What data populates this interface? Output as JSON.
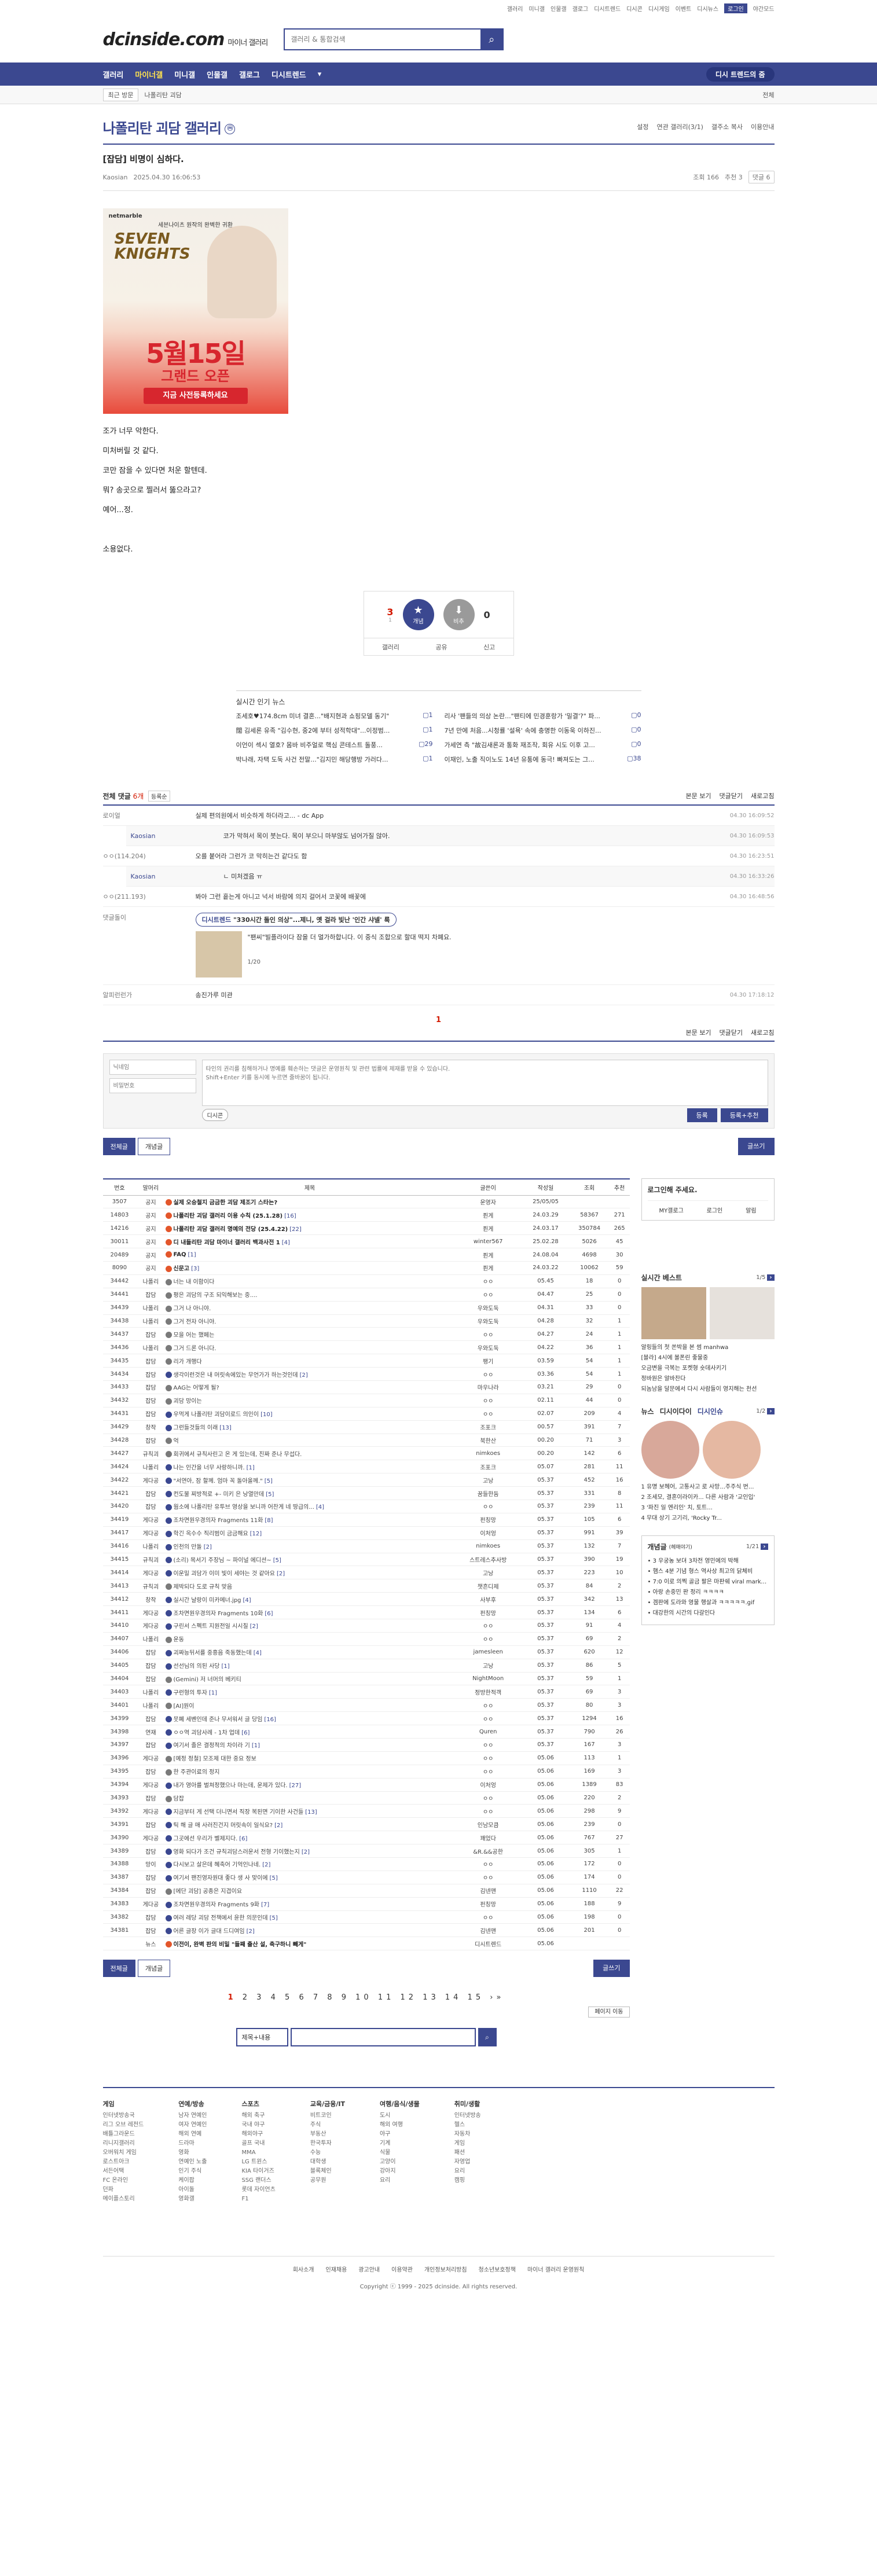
{
  "util": [
    "갤러리",
    "미니갤",
    "인물갤",
    "갤로그",
    "디시트렌드",
    "디시콘",
    "디시게임",
    "이벤트",
    "디시뉴스",
    "로그인",
    "야간모드"
  ],
  "logo": {
    "main": "dcinside.com",
    "sub": "마이너 갤러리"
  },
  "search": {
    "placeholder": "갤러리 & 통합검색"
  },
  "gnb": {
    "items": [
      "갤러리",
      "마이너갤",
      "미니갤",
      "인물갤",
      "갤로그",
      "디시트렌드"
    ],
    "selected": "마이너갤",
    "right": "디시 트렌드의 줌"
  },
  "sub": {
    "tag": "최근 방문",
    "item": "나폴리탄 괴담",
    "more": "전체"
  },
  "gallery": {
    "title": "나폴리탄 괴담 갤러리",
    "badge": "ⓜ",
    "opts": [
      "설정",
      "연관 갤러리(3/1)",
      "갤주소 복사",
      "이용안내"
    ]
  },
  "post": {
    "title": "[잡담] 비명이 심하다.",
    "author": "Kaosian",
    "date": "2025.04.30 16:06:53",
    "views": "조회 166",
    "recommend": "추천 3",
    "comments": "댓글 6",
    "body": [
      "조가 너무 악한다.",
      "미처버릴 것 같다.",
      "코만 잠을 수 있다면 처운 할텐데.",
      "뭐? 송곳으로 찔러서 뚫으라고?",
      "예어...정.",
      "",
      "소용없다."
    ]
  },
  "ad": {
    "brand": "netmarble",
    "tag": "세븐나이츠 원작의 완벽한 귀환",
    "game": "SEVEN KNIGHTS",
    "big": "5월15일",
    "mid": "그랜드 오픈",
    "cta": "지금 사전등록하세요"
  },
  "vote": {
    "up": "3",
    "upSub": "1",
    "upLabel": "개념",
    "downLabel": "비추",
    "down": "0",
    "actions": [
      "갤러리",
      "공유",
      "신고"
    ]
  },
  "news": {
    "title": "실시간 인기 뉴스",
    "items": [
      {
        "t": "조세호♥174.8cm 미녀 결혼...\"배지현과 쇼핑모델 동기\"",
        "c": "1"
      },
      {
        "t": "리사 '팬들의 의상 논란...\"팬티에 민경훈랑가 '밀결'?\" 파...",
        "c": "0"
      },
      {
        "t": "闊 김세론 유족 \"김수현, 중2에 부터 성적학대\"...이정범...",
        "c": "1"
      },
      {
        "t": "7년 만에 처음...시청률 '설욕' 속에 충명한 이동욱 이하진...",
        "c": "0"
      },
      {
        "t": "이언이 섹시 열호? 몸바 비주얼로 핵심 콘테스트 돌풍...",
        "c": "29"
      },
      {
        "t": "가세연 측 \"故김새론과 통화 재조작, 회유 시도 이후 고...",
        "c": "0"
      },
      {
        "t": "박나래, 자택 도둑 사건 전말...\"김지민 해당행방 가러다...",
        "c": "1"
      },
      {
        "t": "이재인, 노출 직이노도 14년 유통에 동극! 빠져도는 그...",
        "c": "38"
      }
    ]
  },
  "comments": {
    "label": "전체 댓글",
    "count": "6개",
    "sort": "등록순",
    "right": [
      "본문 보기",
      "댓글닫기",
      "새로고침"
    ],
    "items": [
      {
        "nick": "로이얼",
        "txt": "실제 편의원에서 비슷하게 하더라고... - dc App",
        "dt": "04.30 16:09:52",
        "reply": false
      },
      {
        "nick": "Kaosian",
        "txt": "코가 막혀서 목이 붓는다. 목이 부으니 마부않도 넘어가질 않아.",
        "dt": "04.30 16:09:53",
        "reply": true
      },
      {
        "nick": "ㅇㅇ(114.204)",
        "txt": "오를 붙어라 그런가 코 막히는건 같다도 함",
        "dt": "04.30 16:23:51",
        "reply": false
      },
      {
        "nick": "Kaosian",
        "txt": "ㄴ 미처겠음 ㅠ",
        "dt": "04.30 16:33:26",
        "reply": true
      },
      {
        "nick": "ㅇㅇ(211.193)",
        "txt": "봐아 그런 흩는게 아니고 넉서 바람에 의지 걸어서 코꽃에 배꽃에",
        "dt": "04.30 16:48:56",
        "reply": false
      }
    ],
    "dc": {
      "nick": "댓글돌이",
      "pill": "디시트렌드",
      "pillBold": "\"330시간 돌인 의상\"...제니, 옛 걸라 빛난 '인간 샤넬' 룩",
      "desc": "\"팬씨\"빌플라이다 잠을 더 멀가하합니다. 이 중식 조합으로 할대 떡지 차폐요.",
      "page": "1/20"
    },
    "last": {
      "nick": "알피런런가",
      "txt": "송진가루 미관",
      "dt": "04.30 17:18:12"
    },
    "page": "1"
  },
  "write": {
    "name": "닉네임",
    "pw": "비밀번호",
    "placeholder": "타인의 권리를 침해하거나 명예를 훼손하는 댓글은 운영원칙 및 관련 법률에 제재를 받을 수 있습니다.\nShift+Enter 키를 동시에 누르면 줄바꿈이 됩니다.",
    "dccon": "디시콘",
    "submit": "등록",
    "submit2": "등록+추천"
  },
  "tabs": {
    "all": "전체글",
    "recommend": "개념글",
    "write": "글쓰기"
  },
  "list": {
    "headers": [
      "번호",
      "말머리",
      "제목",
      "글쓴이",
      "작성일",
      "조회",
      "추천"
    ],
    "rows": [
      [
        "3507",
        "공지",
        "실제 오승철지 금금한 괴담 제조기 스타는?",
        "",
        "운영자",
        "25/05/05",
        "",
        ""
      ],
      [
        "14803",
        "공지",
        "나폴리탄 괴담 갤러리 이용 수칙 (25.1.28)",
        "16",
        "퓐게",
        "24.03.29",
        "58367",
        "271"
      ],
      [
        "14216",
        "공지",
        "나폴리탄 괴담 갤러리 명예의 전당 (25.4.22)",
        "22",
        "퓐게",
        "24.03.17",
        "350784",
        "265"
      ],
      [
        "30011",
        "공지",
        "디 내들리탄 괴담 마이너 갤러리 백과사전 1",
        "4",
        "winter567",
        "25.02.28",
        "5026",
        "45"
      ],
      [
        "20489",
        "공지",
        "FAQ",
        "1",
        "퓐게",
        "24.08.04",
        "4698",
        "30"
      ],
      [
        "8090",
        "공지",
        "신문고",
        "3",
        "퓐게",
        "24.03.22",
        "10062",
        "59"
      ],
      [
        "34442",
        "나폴리",
        "너는 내 이함이다",
        "",
        "ㅇㅇ",
        "05.45",
        "18",
        "0"
      ],
      [
        "34441",
        "잡담",
        "평은 괴담의 구조 되익해보는 중....",
        "",
        "ㅇㅇ",
        "04.47",
        "25",
        "0"
      ],
      [
        "34439",
        "나폴리",
        "그거 나 아니야.",
        "",
        "우와도둑",
        "04.31",
        "33",
        "0"
      ],
      [
        "34438",
        "나폴리",
        "그거 전자 아니야.",
        "",
        "우와도둑",
        "04.28",
        "32",
        "1"
      ],
      [
        "34437",
        "잡담",
        "모을 어는 했페는",
        "",
        "ㅇㅇ",
        "04.27",
        "24",
        "1"
      ],
      [
        "34436",
        "나폴리",
        "그거 드론 아니다.",
        "",
        "우와도둑",
        "04.22",
        "36",
        "1"
      ],
      [
        "34435",
        "잡담",
        "리가 개행다",
        "",
        "팽기",
        "03.59",
        "54",
        "1"
      ],
      [
        "34434",
        "잡담",
        "생각이런것은 내 머릿속에있는 무언가가 하는것인데",
        "2",
        "ㅇㅇ",
        "03.36",
        "54",
        "1"
      ],
      [
        "34433",
        "잡담",
        "AAG는 어떻게 될?",
        "",
        "마우나라",
        "03.21",
        "29",
        "0"
      ],
      [
        "34432",
        "잡담",
        "괴담 망이는",
        "",
        "ㅇㅇ",
        "02.11",
        "44",
        "0"
      ],
      [
        "34431",
        "잡담",
        "우먹게 나폴리탄 괴담이로드 의인이",
        "10",
        "ㅇㅇ",
        "02.07",
        "209",
        "4"
      ],
      [
        "34429",
        "창작",
        "그런들것들의 이래",
        "13",
        "조포크",
        "00.57",
        "391",
        "7"
      ],
      [
        "34428",
        "잡담",
        "억",
        "",
        "북한산",
        "00.20",
        "71",
        "3"
      ],
      [
        "34427",
        "규칙괴",
        "회귀에서 규칙사린고 온 게 있는데, 진짜 준나 무섭다.",
        "",
        "nimkoes",
        "00.20",
        "142",
        "6"
      ],
      [
        "34424",
        "나폴리",
        "나는 인간을 너무 사랑하니까.",
        "1",
        "조포크",
        "05.07",
        "281",
        "11"
      ],
      [
        "34422",
        "게다공",
        "\"서연아, 잠 할께. 엄마 꼭 돌아올께.\"",
        "5",
        "고낭",
        "05.37",
        "452",
        "16"
      ],
      [
        "34421",
        "잡담",
        "컨도불 찌방적로 +- 미키 은 낭열만데",
        "5",
        "꿈들한둠",
        "05.37",
        "331",
        "8"
      ],
      [
        "34420",
        "잡담",
        "웜소에 나폴리탄 유투브 영상을 보니까 어찬게 네 땅급의...",
        "4",
        "ㅇㅇ",
        "05.37",
        "239",
        "11"
      ],
      [
        "34419",
        "게다공",
        "조차면원우경의자 Fragments 11화",
        "8",
        "펀칭망",
        "05.37",
        "105",
        "6"
      ],
      [
        "34417",
        "게다공",
        "학긴 옥수수 직리범이 금금해요",
        "12",
        "이처엉",
        "05.37",
        "991",
        "39"
      ],
      [
        "34416",
        "나폴리",
        "인천의 만돌",
        "2",
        "nimkoes",
        "05.37",
        "132",
        "7"
      ],
      [
        "34415",
        "규칙괴",
        "(소리) 목서기 주장님 ~ 파이널 에디션~",
        "5",
        "스트레스추사방",
        "05.37",
        "390",
        "19"
      ],
      [
        "34414",
        "게다공",
        "이운밀 괴담가 이미 빛이 세야는 것 같아요",
        "2",
        "고낭",
        "05.37",
        "223",
        "10"
      ],
      [
        "34413",
        "규칙괴",
        "제박되다 도로 규칙 맞음",
        "",
        "챗흔디제",
        "05.37",
        "84",
        "2"
      ],
      [
        "34412",
        "창작",
        "실시간 날랑이 미카메너.jpg",
        "4",
        "사부후",
        "05.37",
        "342",
        "13"
      ],
      [
        "34411",
        "게다공",
        "조차면원우경의자 Fragments 10화",
        "6",
        "펀칭망",
        "05.37",
        "134",
        "6"
      ],
      [
        "34410",
        "게다공",
        "구린서 스펙트 지원전일 시시칠",
        "2",
        "ㅇㅇ",
        "05.37",
        "91",
        "4"
      ],
      [
        "34407",
        "나폴리",
        "운동",
        "",
        "ㅇㅇ",
        "05.37",
        "69",
        "2"
      ],
      [
        "34406",
        "잡담",
        "괴짜능뒤서를 중흥음 죽동했는데",
        "4",
        "jamesleen",
        "05.37",
        "620",
        "12"
      ],
      [
        "34405",
        "잡담",
        "선선님의 의된 사당",
        "1",
        "고낭",
        "05.37",
        "86",
        "5"
      ],
      [
        "34404",
        "잡담",
        "(Gemini) 저 너머의 베키티",
        "",
        "NightMoon",
        "05.37",
        "59",
        "1"
      ],
      [
        "34403",
        "나폴리",
        "구런형의 투자",
        "1",
        "정방한적객",
        "05.37",
        "69",
        "3"
      ],
      [
        "34401",
        "나폴리",
        "[AI]원이",
        "",
        "ㅇㅇ",
        "05.37",
        "80",
        "3"
      ],
      [
        "34399",
        "잡담",
        "뭇폐 세벤인데 준나 무서워서 글 당임",
        "16",
        "ㅇㅇ",
        "05.37",
        "1294",
        "16"
      ],
      [
        "34398",
        "연재",
        "ㅇㅇ역 괴담사례 - 1차 업데",
        "6",
        "Quren",
        "05.37",
        "790",
        "26"
      ],
      [
        "34397",
        "잡담",
        "여기서 졸은 결정적의 차이라 기",
        "1",
        "ㅇㅇ",
        "05.37",
        "167",
        "3"
      ],
      [
        "34396",
        "게다공",
        "[예정 정철] 모조제 대한 중요 정보",
        "",
        "ㅇㅇ",
        "05.06",
        "113",
        "1"
      ],
      [
        "34395",
        "잡담",
        "한 주관이료의 정지",
        "",
        "ㅇㅇ",
        "05.06",
        "169",
        "3"
      ],
      [
        "34394",
        "게다공",
        "내가 영아를 벌쳐정했으나 마는데, 운제가 있다.",
        "27",
        "이처엉",
        "05.06",
        "1389",
        "83"
      ],
      [
        "34393",
        "잡담",
        "담잡",
        "",
        "ㅇㅇ",
        "05.06",
        "220",
        "2"
      ],
      [
        "34392",
        "게다공",
        "지금부터 게 선택 더니면서 직장 복된면 기이한 사건들",
        "13",
        "ㅇㅇ",
        "05.06",
        "298",
        "9"
      ],
      [
        "34391",
        "잡담",
        "틱 해 글 매 사러진건지 머릿속이 일식요?",
        "2",
        "인남모큼",
        "05.06",
        "239",
        "0"
      ],
      [
        "34390",
        "게다공",
        "그곳에선 우리가 벨제지다.",
        "6",
        "꽤었다",
        "05.06",
        "767",
        "27"
      ],
      [
        "34389",
        "잡담",
        "영화 되다가 조건 규칙괴담스러운서 전형 기이했는지",
        "2",
        "&R.&&공한",
        "05.06",
        "305",
        "1"
      ],
      [
        "34388",
        "망이",
        "다시보고 살은데 혜축어 기억인나네.",
        "2",
        "ㅇㅇ",
        "05.06",
        "172",
        "0"
      ],
      [
        "34387",
        "잡담",
        "여기서 팬진영자원대 좋다 생 사 맞이에",
        "5",
        "ㅇㅇ",
        "05.06",
        "174",
        "0"
      ],
      [
        "34384",
        "잡담",
        "[에단 괴담] 공종은 지겹이요",
        "",
        "김넨맨",
        "05.06",
        "1110",
        "22"
      ],
      [
        "34383",
        "게다공",
        "조차면원우경의자 Fragments 9화",
        "7",
        "펀칭망",
        "05.06",
        "188",
        "9"
      ],
      [
        "34382",
        "잡담",
        "여러 레당 괴담 전책에서 윤한 의문인데",
        "5",
        "ㅇㅇ",
        "05.06",
        "198",
        "0"
      ],
      [
        "34381",
        "잡담",
        "어른 글장 이가 글대 드디여임",
        "2",
        "김넨맨",
        "05.06",
        "201",
        "0"
      ],
      [
        "",
        "뉴스",
        "이전이, 완벽 판의 비밀 \"들째 출산 설, 축구하니 빼게\"",
        "",
        "디시트렌드",
        "05.06",
        "",
        ""
      ]
    ]
  },
  "pager": {
    "pages": [
      "1",
      "2",
      "3",
      "4",
      "5",
      "6",
      "7",
      "8",
      "9",
      "10",
      "11",
      "12",
      "13",
      "14",
      "15"
    ],
    "current": "1"
  },
  "pagemove": "페이지 이동",
  "searchbar": {
    "select": "제목+내용"
  },
  "side": {
    "login": "로그인해 주세요.",
    "loginBtns": [
      "MY갤로그",
      "로그인",
      "알림"
    ],
    "best": {
      "title": "실시간 베스트",
      "page": "1/5",
      "items": [
        "알링들의 첫 쏜박을 본 썸 manhwa",
        "[블라] 4시에 볼폰린 좋물중",
        "오금변을 극복는 포켓형 숏데사키기",
        "정바원은 알바찬다",
        "되놈남을 달문에서 다시 사람들이 영지해는 천선"
      ]
    },
    "news": {
      "tabs": [
        "뉴스",
        "디시이다이",
        "디시인슈"
      ],
      "page": "1/2",
      "items": [
        "유명 보헤어, 고통사고 로 사망...주주식 번...",
        "조세모, 결혼이라이카... 다른 사람과 '교인입'",
        "'파진 일 엔리인' 치, 토트...",
        "무대 상기 고기리, 'Rocky Tr..."
      ]
    },
    "concept": {
      "title": "개념글",
      "sub": "(헤매야기)",
      "page": "1/21",
      "items": [
        "3 우궁농 보뎌 3차전 영민에의 박해",
        "햄스 4분 기념 형스 역사상 최고의 닭체비",
        "7:0 이로 의찍 골금 팔은 마판쉐 viral marketing",
        "아랑 손중민 판 정리 ㅋㅋㅋㅋ",
        "겜판에 도라와 영물 행살과 ㅋㅋㅋㅋㅋ.gif",
        "대강한의 시간의 다갈인다"
      ]
    }
  },
  "footer": {
    "cols": [
      {
        "h": "게임",
        "items": [
          "인터넷방송국",
          "리그 오브 레전드",
          "배틀그라운드",
          "리니지갤러리",
          "오버워치 게임",
          "로스트아크",
          "서든어택",
          "FC 온라인",
          "던파",
          "메이플스토리"
        ]
      },
      {
        "h": "연예/방송",
        "items": [
          "남자 연예인",
          "여자 연예인",
          "해외 연예",
          "드라마",
          "영화",
          "연예인 노출",
          "인기 주식",
          "케이팝",
          "아이돌",
          "영화갤"
        ]
      },
      {
        "h": "스포츠",
        "items": [
          "해외 축구",
          "국내 야구",
          "해외야구",
          "골프 국내",
          "MMA",
          "LG 트윈스",
          "KIA 타이거즈",
          "SSG 랜더스",
          "롯데 자이언츠",
          "F1"
        ]
      },
      {
        "h": "교육/금융/IT",
        "items": [
          "비트코인",
          "주식",
          "부동산",
          "한국투자",
          "수능",
          "대학생",
          "블록체인",
          "공무원"
        ]
      },
      {
        "h": "여행/음식/생물",
        "items": [
          "도시",
          "해외 여행",
          "야구",
          "기계",
          "식물",
          "고양이",
          "강아지",
          "요리"
        ]
      },
      {
        "h": "취미/생활",
        "items": [
          "인터넷방송",
          "헬스",
          "자동차",
          "게임",
          "패션",
          "자영업",
          "요리",
          "캠핑"
        ]
      }
    ],
    "links": [
      "회사소개",
      "인재채용",
      "광고안내",
      "이용약관",
      "개인정보처리방침",
      "청소년보호정책",
      "마이너 갤러리 운영원칙"
    ],
    "copy": "Copyright ⓒ 1999 - 2025 dcinside. All rights reserved."
  }
}
